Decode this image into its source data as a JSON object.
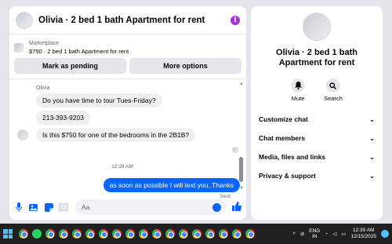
{
  "header": {
    "title": "Olivia · 2 bed 1 bath Apartment for rent",
    "info_icon": "info-icon"
  },
  "marketplace": {
    "label": "Marketplace",
    "listing": "$750 · 2 bed 1 bath Apartment for rent"
  },
  "actions": {
    "mark_pending": "Mark as pending",
    "more_options": "More options"
  },
  "chat": {
    "sender": "Olivia",
    "messages": [
      {
        "direction": "in",
        "text": "Do you have time to tour Tues-Friday?"
      },
      {
        "direction": "in",
        "text": "213-393-9203"
      },
      {
        "direction": "in",
        "text": "Is this $750 for one of the bedrooms in the 2B1B?"
      },
      {
        "direction": "out",
        "text": "as soon as possible I will text you..Thanks"
      }
    ],
    "timestamp": "12:39 AM",
    "status": "Sent"
  },
  "composer": {
    "placeholder": "Aa",
    "icons": [
      "microphone-icon",
      "photo-icon",
      "sticker-icon",
      "gif-icon",
      "emoji-icon",
      "like-icon"
    ]
  },
  "right_panel": {
    "title": "Olivia · 2 bed 1 bath Apartment for rent",
    "mute_label": "Mute",
    "search_label": "Search",
    "menu": [
      "Customize chat",
      "Chat members",
      "Media, files and links",
      "Privacy & support"
    ]
  },
  "taskbar": {
    "language": "ENG",
    "region": "IN",
    "time": "12:39 AM",
    "date": "12/15/2025"
  },
  "colors": {
    "accent": "#0866ff",
    "info": "#a633d6",
    "taskbar": "#202020"
  }
}
